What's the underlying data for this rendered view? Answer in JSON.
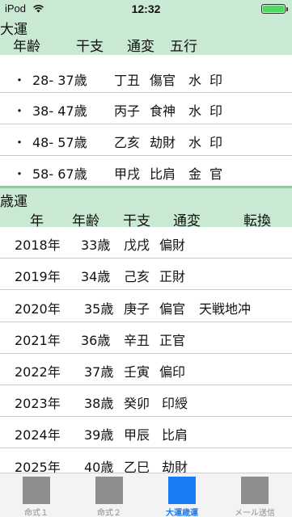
{
  "status_bar": {
    "carrier": "iPod",
    "time": "12:32",
    "battery_level": 1.0,
    "battery_color": "#4cd964"
  },
  "daiun": {
    "title": "大運",
    "columns": [
      "年齢",
      "干支",
      "通変",
      "五行"
    ],
    "rows": [
      {
        "bullet": "・",
        "age": "28- 37歳",
        "kanshi": "丁丑",
        "tsuhen": "傷官",
        "gogyo": "水",
        "extra": "印"
      },
      {
        "bullet": "・",
        "age": "38- 47歳",
        "kanshi": "丙子",
        "tsuhen": "食神",
        "gogyo": "水",
        "extra": "印"
      },
      {
        "bullet": "・",
        "age": "48- 57歳",
        "kanshi": "乙亥",
        "tsuhen": "劫財",
        "gogyo": "水",
        "extra": "印"
      },
      {
        "bullet": "・",
        "age": "58- 67歳",
        "kanshi": "甲戌",
        "tsuhen": "比肩",
        "gogyo": "金",
        "extra": "官"
      }
    ]
  },
  "saiun": {
    "title": "歳運",
    "columns": [
      "年",
      "年齢",
      "干支",
      "通変",
      "転換"
    ],
    "rows": [
      {
        "year": "2018年",
        "age": "33歳",
        "kanshi": "戊戌",
        "tsuhen": "偏財",
        "tenkan": ""
      },
      {
        "year": "2019年",
        "age": "34歳",
        "kanshi": "己亥",
        "tsuhen": "正財",
        "tenkan": ""
      },
      {
        "year": "2020年",
        "age": "35歳",
        "kanshi": "庚子",
        "tsuhen": "偏官",
        "tenkan": "天戦地冲"
      },
      {
        "year": "2021年",
        "age": "36歳",
        "kanshi": "辛丑",
        "tsuhen": "正官",
        "tenkan": ""
      },
      {
        "year": "2022年",
        "age": "37歳",
        "kanshi": "壬寅",
        "tsuhen": "偏印",
        "tenkan": ""
      },
      {
        "year": "2023年",
        "age": "38歳",
        "kanshi": "癸卯",
        "tsuhen": "印綬",
        "tenkan": ""
      },
      {
        "year": "2024年",
        "age": "39歳",
        "kanshi": "甲辰",
        "tsuhen": "比肩",
        "tenkan": ""
      },
      {
        "year": "2025年",
        "age": "40歳",
        "kanshi": "乙巳",
        "tsuhen": "劫財",
        "tenkan": ""
      }
    ]
  },
  "tab_bar": {
    "tabs": [
      {
        "label": "命式１",
        "active": false
      },
      {
        "label": "命式２",
        "active": false
      },
      {
        "label": "大運歳運",
        "active": true
      },
      {
        "label": "メール送信",
        "active": false
      }
    ],
    "active_color": "#1a7cf5",
    "inactive_color": "#8e8e8e"
  },
  "colors": {
    "header_background": "#c9e9d3"
  }
}
